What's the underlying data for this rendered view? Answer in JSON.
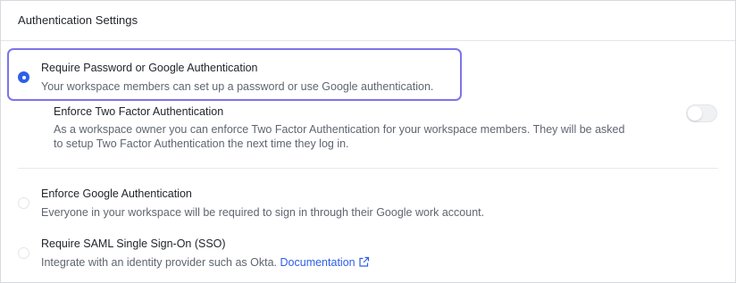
{
  "header": {
    "title": "Authentication Settings"
  },
  "options": [
    {
      "label": "Require Password or Google Authentication",
      "description": "Your workspace members can set up a password or use Google authentication.",
      "selected": true
    },
    {
      "label": "Enforce Google Authentication",
      "description": "Everyone in your workspace will be required to sign in through their Google work account.",
      "selected": false
    },
    {
      "label": "Require SAML Single Sign-On (SSO)",
      "description": "Integrate with an identity provider such as Okta.",
      "link_label": "Documentation",
      "link_icon": "external-link-icon",
      "selected": false
    }
  ],
  "two_factor": {
    "label": "Enforce Two Factor Authentication",
    "description_line1": "As a workspace owner you can enforce Two Factor Authentication for your workspace members. They will be asked",
    "description_line2": "to setup Two Factor Authentication the next time they log in.",
    "enabled": false
  },
  "colors": {
    "accent": "#2d5fe8",
    "selected_border": "#7c74ea",
    "muted_text": "#5f6570"
  }
}
